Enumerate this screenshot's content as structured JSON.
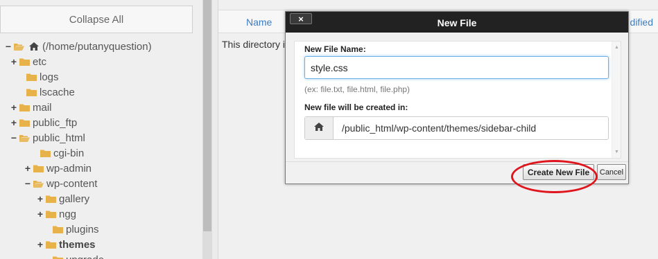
{
  "tree": {
    "collapse_all_label": "Collapse All",
    "items": [
      {
        "toggle": "−",
        "icon": "folder-open-icon",
        "home": true,
        "label": "(/home/putanyquestion)"
      },
      {
        "toggle": "+",
        "icon": "folder-icon",
        "label": "etc"
      },
      {
        "toggle": "",
        "icon": "folder-icon",
        "label": "logs"
      },
      {
        "toggle": "",
        "icon": "folder-icon",
        "label": "lscache"
      },
      {
        "toggle": "+",
        "icon": "folder-icon",
        "label": "mail"
      },
      {
        "toggle": "+",
        "icon": "folder-icon",
        "label": "public_ftp"
      },
      {
        "toggle": "−",
        "icon": "folder-open-icon",
        "label": "public_html"
      },
      {
        "toggle": "",
        "icon": "folder-icon",
        "label": "cgi-bin"
      },
      {
        "toggle": "+",
        "icon": "folder-icon",
        "label": "wp-admin"
      },
      {
        "toggle": "−",
        "icon": "folder-open-icon",
        "label": "wp-content"
      },
      {
        "toggle": "+",
        "icon": "folder-icon",
        "label": "gallery"
      },
      {
        "toggle": "+",
        "icon": "folder-icon",
        "label": "ngg"
      },
      {
        "toggle": "",
        "icon": "folder-icon",
        "label": "plugins"
      },
      {
        "toggle": "+",
        "icon": "folder-icon",
        "label": "themes",
        "bold": true
      },
      {
        "toggle": "",
        "icon": "folder-icon",
        "label": "upgrade"
      }
    ]
  },
  "file_pane": {
    "col_name": "Name",
    "col_modified": "dified",
    "empty_message": "This directory i"
  },
  "dialog": {
    "title": "New File",
    "close_label": "×",
    "file_name_label": "New File Name:",
    "file_name_value": "style.css",
    "file_name_hint": "(ex: file.txt, file.html, file.php)",
    "location_label": "New file will be created in:",
    "location_icon": "home-icon",
    "location_path": "/public_html/wp-content/themes/sidebar-child",
    "create_button": "Create New File",
    "cancel_button": "Cancel"
  },
  "colors": {
    "folder": "#e8b24a",
    "link": "#3d7cc0",
    "annotation_ring": "#e0141c"
  }
}
